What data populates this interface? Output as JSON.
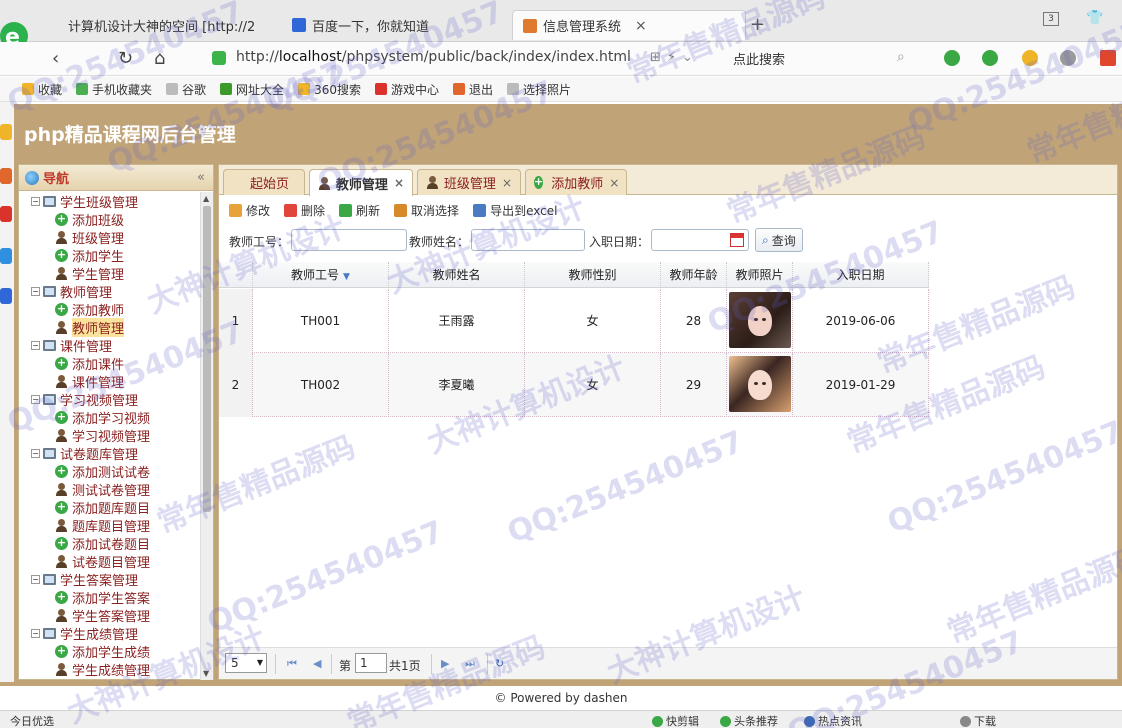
{
  "browser": {
    "tabs": [
      {
        "title": "计算机设计大神的空间 [http://2",
        "active": false,
        "fav_color": "#f0b429"
      },
      {
        "title": "百度一下，你就知道",
        "active": false,
        "fav_color": "#2f66d8"
      },
      {
        "title": "信息管理系统",
        "active": true,
        "fav_color": "#e07a2e"
      }
    ],
    "close_glyph": "×",
    "new_tab_glyph": "+",
    "tab_count": "3",
    "address": {
      "url_prefix": "http://",
      "url_host": "localhost",
      "url_path": "/phpsystem/public/back/index/index.html",
      "search_placeholder": "点此搜索"
    },
    "bookmarks": [
      {
        "label": "收藏",
        "icon": "star-icon",
        "color": "#f0b429"
      },
      {
        "label": "手机收藏夹",
        "icon": "phone-icon",
        "color": "#4caf50"
      },
      {
        "label": "谷歌",
        "icon": "page-icon",
        "color": "#bbbbbb"
      },
      {
        "label": "网址大全",
        "icon": "ie-icon",
        "color": "#3c9a28"
      },
      {
        "label": "360搜索",
        "icon": "circle-icon",
        "color": "#f0b429"
      },
      {
        "label": "游戏中心",
        "icon": "game-icon",
        "color": "#d9332c"
      },
      {
        "label": "退出",
        "icon": "exit-icon",
        "color": "#e0662c"
      },
      {
        "label": "选择照片",
        "icon": "page-icon",
        "color": "#bbbbbb"
      }
    ]
  },
  "app": {
    "title": "php精品课程网后台管理",
    "nav_title": "导航",
    "collapse_glyph": "«",
    "nav_tree": [
      {
        "label": "学生班级管理",
        "children": [
          {
            "label": "添加班级",
            "icon": "plus"
          },
          {
            "label": "班级管理",
            "icon": "user"
          },
          {
            "label": "添加学生",
            "icon": "plus"
          },
          {
            "label": "学生管理",
            "icon": "user"
          }
        ]
      },
      {
        "label": "教师管理",
        "children": [
          {
            "label": "添加教师",
            "icon": "plus"
          },
          {
            "label": "教师管理",
            "icon": "user",
            "selected": true
          }
        ]
      },
      {
        "label": "课件管理",
        "children": [
          {
            "label": "添加课件",
            "icon": "plus"
          },
          {
            "label": "课件管理",
            "icon": "user"
          }
        ]
      },
      {
        "label": "学习视频管理",
        "children": [
          {
            "label": "添加学习视频",
            "icon": "plus"
          },
          {
            "label": "学习视频管理",
            "icon": "user"
          }
        ]
      },
      {
        "label": "试卷题库管理",
        "children": [
          {
            "label": "添加测试试卷",
            "icon": "plus"
          },
          {
            "label": "测试试卷管理",
            "icon": "user"
          },
          {
            "label": "添加题库题目",
            "icon": "plus"
          },
          {
            "label": "题库题目管理",
            "icon": "user"
          },
          {
            "label": "添加试卷题目",
            "icon": "plus"
          },
          {
            "label": "试卷题目管理",
            "icon": "user"
          }
        ]
      },
      {
        "label": "学生答案管理",
        "children": [
          {
            "label": "添加学生答案",
            "icon": "plus"
          },
          {
            "label": "学生答案管理",
            "icon": "user"
          }
        ]
      },
      {
        "label": "学生成绩管理",
        "children": [
          {
            "label": "添加学生成绩",
            "icon": "plus"
          },
          {
            "label": "学生成绩管理",
            "icon": "user"
          }
        ]
      }
    ],
    "content_tabs": [
      {
        "label": "起始页",
        "icon": "none",
        "active": false,
        "closable": false
      },
      {
        "label": "教师管理",
        "icon": "user",
        "active": true,
        "closable": true
      },
      {
        "label": "班级管理",
        "icon": "user",
        "active": false,
        "closable": true
      },
      {
        "label": "添加教师",
        "icon": "plus",
        "active": false,
        "closable": true
      }
    ],
    "toolbar": [
      {
        "label": "修改",
        "icon": "edit-icon",
        "color": "#e8a23a"
      },
      {
        "label": "删除",
        "icon": "delete-icon",
        "color": "#e0463c"
      },
      {
        "label": "刷新",
        "icon": "refresh-icon",
        "color": "#3aa845"
      },
      {
        "label": "取消选择",
        "icon": "undo-icon",
        "color": "#d88a2a"
      },
      {
        "label": "导出到excel",
        "icon": "export-icon",
        "color": "#4a7bc2"
      }
    ],
    "search": {
      "teacher_no_label": "教师工号：",
      "teacher_name_label": "教师姓名：",
      "hire_date_label": "入职日期：",
      "query_label": "查询"
    },
    "grid": {
      "columns": [
        "教师工号",
        "教师姓名",
        "教师性别",
        "教师年龄",
        "教师照片",
        "入职日期"
      ],
      "rows": [
        {
          "row_no": "1",
          "teacher_no": "TH001",
          "name": "王雨露",
          "gender": "女",
          "age": "28",
          "hire_date": "2019-06-06"
        },
        {
          "row_no": "2",
          "teacher_no": "TH002",
          "name": "李夏曦",
          "gender": "女",
          "age": "29",
          "hire_date": "2019-01-29"
        }
      ]
    },
    "pager": {
      "page_size": "5",
      "page_prefix": "第",
      "current_page": "1",
      "total_pages": "共1页"
    },
    "footer": "© Powered by dashen"
  },
  "statusbar": {
    "left": "今日优选",
    "items": [
      "快剪辑",
      "头条推荐",
      "热点资讯",
      "下载"
    ]
  },
  "watermark": {
    "texts": [
      "QQ:254540457",
      "大神计算机设计",
      "常年售精品源码"
    ]
  }
}
